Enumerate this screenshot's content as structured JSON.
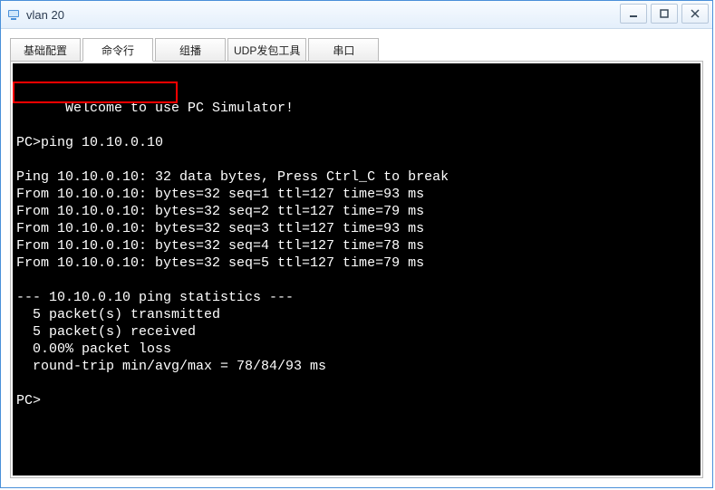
{
  "window": {
    "title": "vlan 20"
  },
  "tabs": [
    {
      "label": "基础配置",
      "active": false
    },
    {
      "label": "命令行",
      "active": true
    },
    {
      "label": "组播",
      "active": false
    },
    {
      "label": "UDP发包工具",
      "active": false
    },
    {
      "label": "串口",
      "active": false
    }
  ],
  "terminal": {
    "lines": [
      "Welcome to use PC Simulator!",
      "",
      "PC>ping 10.10.0.10",
      "",
      "Ping 10.10.0.10: 32 data bytes, Press Ctrl_C to break",
      "From 10.10.0.10: bytes=32 seq=1 ttl=127 time=93 ms",
      "From 10.10.0.10: bytes=32 seq=2 ttl=127 time=79 ms",
      "From 10.10.0.10: bytes=32 seq=3 ttl=127 time=93 ms",
      "From 10.10.0.10: bytes=32 seq=4 ttl=127 time=78 ms",
      "From 10.10.0.10: bytes=32 seq=5 ttl=127 time=79 ms",
      "",
      "--- 10.10.0.10 ping statistics ---",
      "  5 packet(s) transmitted",
      "  5 packet(s) received",
      "  0.00% packet loss",
      "  round-trip min/avg/max = 78/84/93 ms",
      "",
      "PC>"
    ],
    "highlighted_command": "PC>ping 10.10.0.10"
  }
}
